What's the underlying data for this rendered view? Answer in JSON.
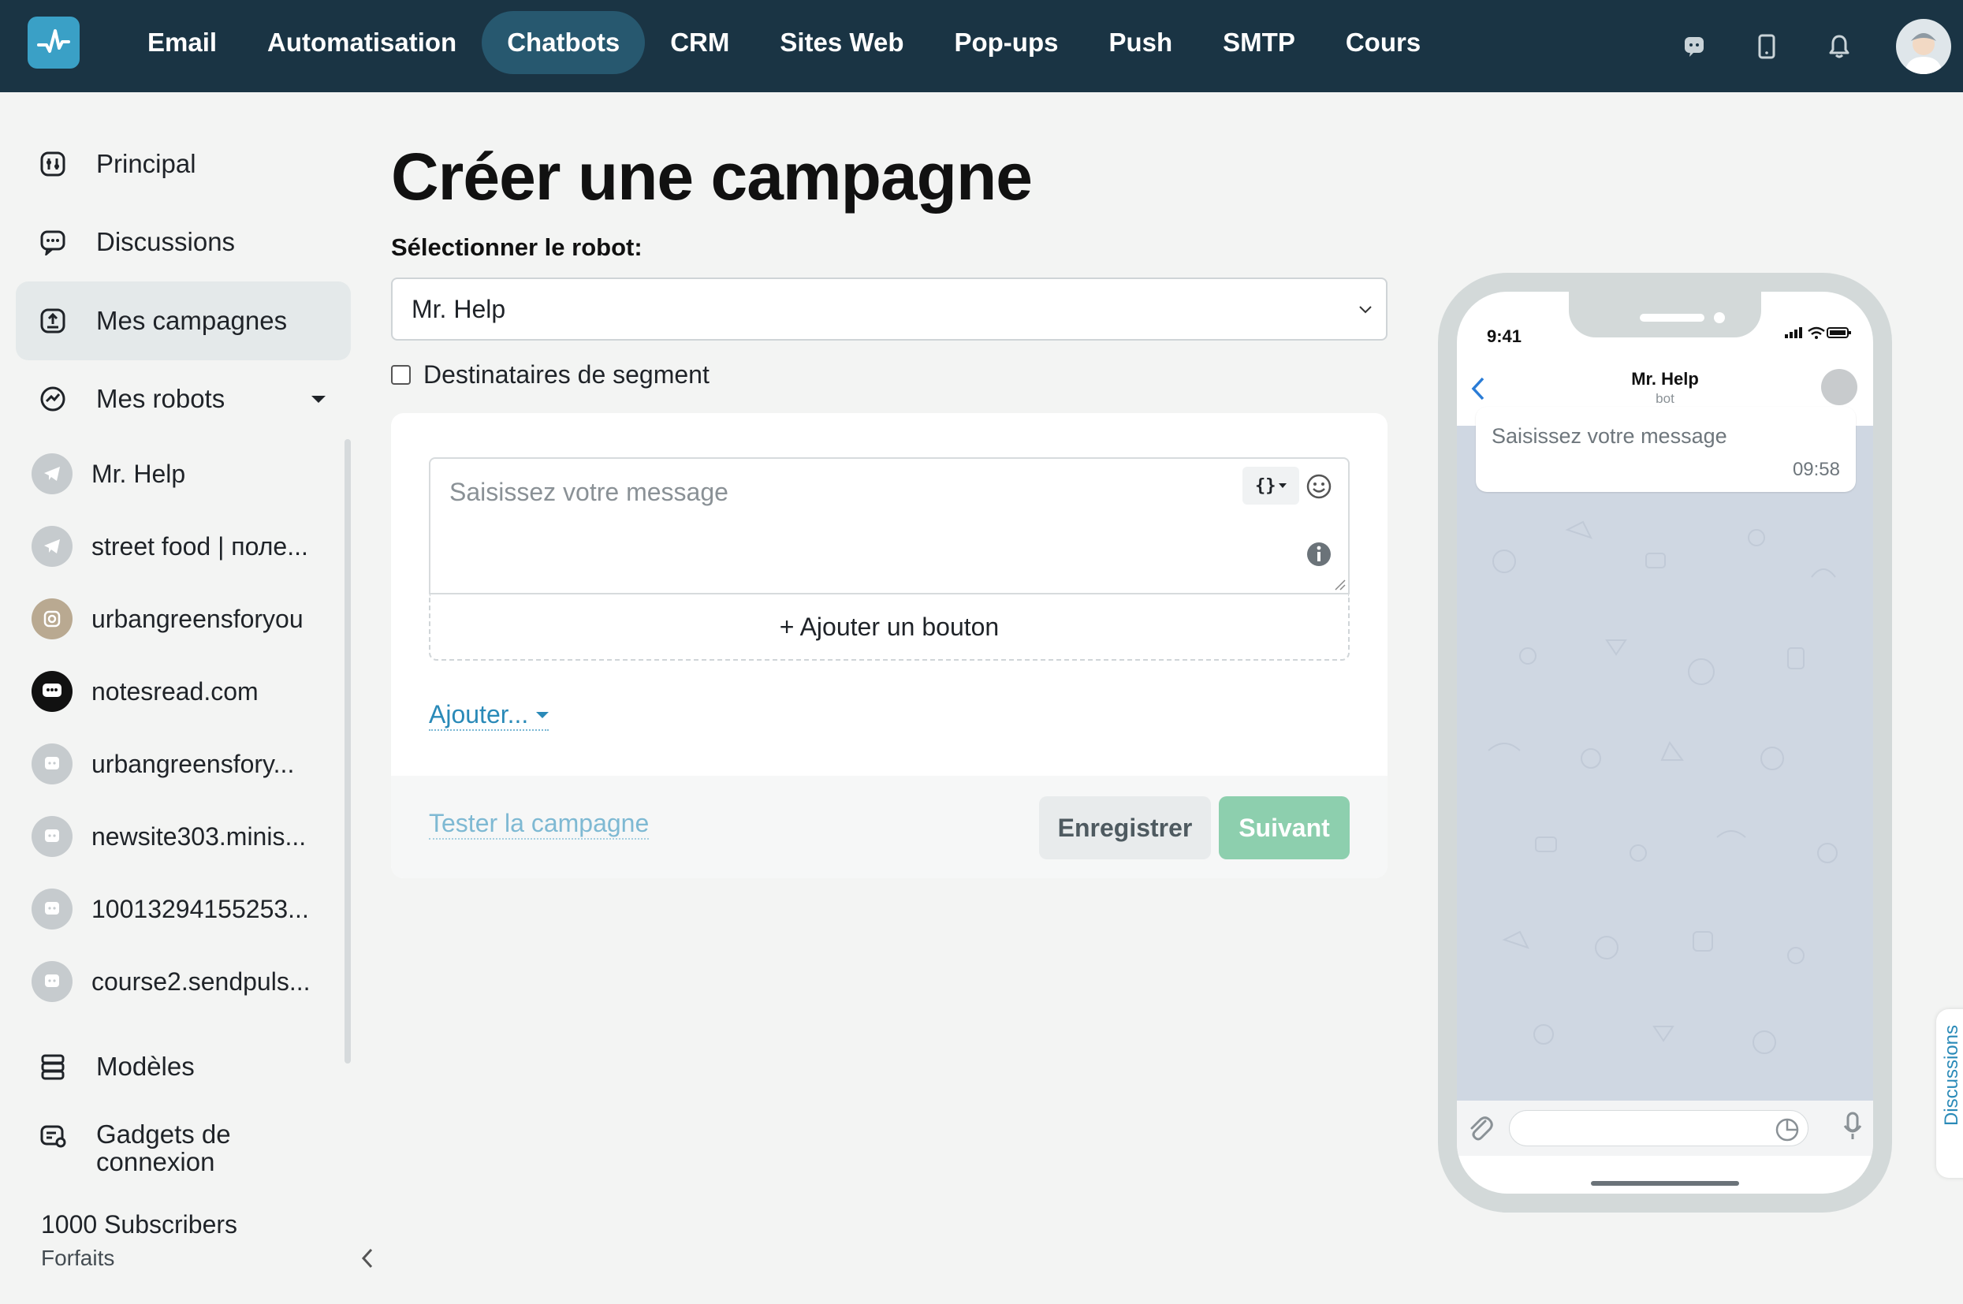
{
  "topnav": {
    "items": [
      {
        "label": "Email",
        "active": false
      },
      {
        "label": "Automatisation",
        "active": false
      },
      {
        "label": "Chatbots",
        "active": true
      },
      {
        "label": "CRM",
        "active": false
      },
      {
        "label": "Sites Web",
        "active": false
      },
      {
        "label": "Pop-ups",
        "active": false
      },
      {
        "label": "Push",
        "active": false
      },
      {
        "label": "SMTP",
        "active": false
      },
      {
        "label": "Cours",
        "active": false
      }
    ],
    "icons": [
      "chat-support-icon",
      "mobile-icon",
      "bell-icon",
      "user-avatar"
    ]
  },
  "sidebar": {
    "items": {
      "principal": "Principal",
      "discussions": "Discussions",
      "campaigns": "Mes campagnes",
      "robots": "Mes robots",
      "templates": "Modèles",
      "widgets": "Gadgets de connexion"
    },
    "bots": [
      {
        "label": "Mr. Help",
        "icon": "telegram-icon"
      },
      {
        "label": "street food | поле...",
        "icon": "telegram-icon"
      },
      {
        "label": "urbangreensforyou",
        "icon": "instagram-avatar"
      },
      {
        "label": "notesread.com",
        "icon": "chat-avatar-dark"
      },
      {
        "label": "urbangreensfory...",
        "icon": "chat-icon"
      },
      {
        "label": "newsite303.minis...",
        "icon": "chat-icon"
      },
      {
        "label": "10013294155253...",
        "icon": "chat-icon"
      },
      {
        "label": "course2.sendpuls...",
        "icon": "chat-icon"
      }
    ],
    "plan_title": "1000 Subscribers",
    "plan_sub": "Forfaits"
  },
  "main": {
    "title": "Créer une campagne",
    "robot_label": "Sélectionner le robot:",
    "robot_value": "Mr. Help",
    "segment_label": "Destinataires de segment",
    "segment_checked": false,
    "message_placeholder": "Saisissez votre message",
    "add_button": "+ Ajouter un bouton",
    "add_more": "Ajouter...",
    "test_link": "Tester la campagne",
    "save_label": "Enregistrer",
    "next_label": "Suivant"
  },
  "phone": {
    "time": "9:41",
    "chat_name": "Mr. Help",
    "chat_sub": "bot",
    "bubble_text": "Saisissez votre message",
    "bubble_time": "09:58"
  },
  "side_tab": "Discussions",
  "colors": {
    "topbar": "#1a3444",
    "nav_active": "#27586f",
    "accent": "#2a8ab8",
    "next_button": "#8dcfae"
  }
}
